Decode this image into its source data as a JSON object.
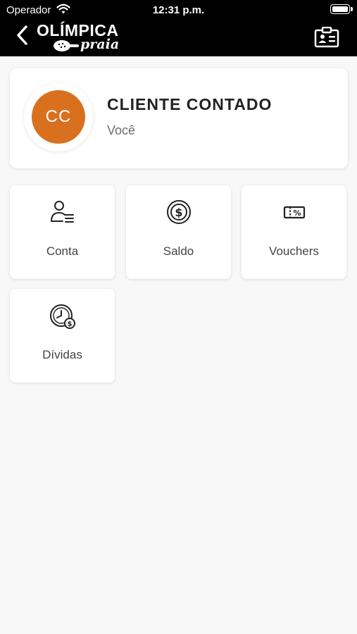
{
  "status_bar": {
    "carrier": "Operador",
    "time": "12:31 p.m."
  },
  "header": {
    "logo_line1": "OLÍMPICA",
    "logo_line2": "praia",
    "back_icon": "chevron-left-icon",
    "right_icon": "contact-card-icon"
  },
  "profile": {
    "initials": "CC",
    "name": "CLIENTE CONTADO",
    "role": "Você",
    "avatar_color": "#d9701e"
  },
  "menu": [
    {
      "label": "Conta",
      "icon": "user-list-icon"
    },
    {
      "label": "Saldo",
      "icon": "dollar-coin-icon"
    },
    {
      "label": "Vouchers",
      "icon": "voucher-ticket-icon"
    },
    {
      "label": "Dívidas",
      "icon": "overdue-clock-icon"
    }
  ],
  "colors": {
    "header_bg": "#000000",
    "page_bg": "#f8f8f8",
    "accent": "#d9701e"
  }
}
